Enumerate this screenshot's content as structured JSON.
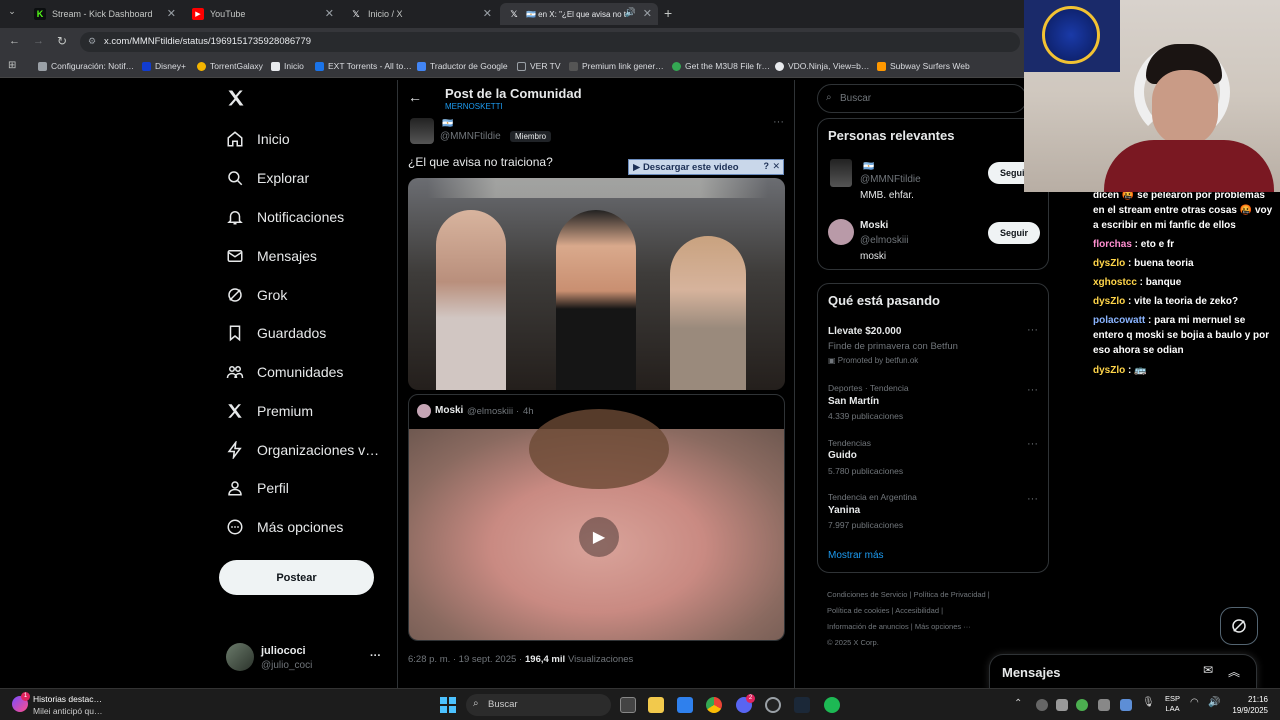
{
  "browser": {
    "tabs": [
      {
        "label": "Stream - Kick Dashboard",
        "favicon": "K",
        "color": "#53fc18"
      },
      {
        "label": "YouTube",
        "favicon": "▶",
        "color": "#ff0000"
      },
      {
        "label": "Inicio / X",
        "favicon": "X",
        "color": "#e8eaed"
      },
      {
        "label": "🇦🇷 en X: \"¿El que avisa no tr…",
        "favicon": "X",
        "color": "#e8eaed"
      }
    ],
    "url": "x.com/MMNFtildie/status/1969151735928086779",
    "bookmarks": [
      {
        "label": "Configuración: Notif…",
        "color": "#9aa0a6"
      },
      {
        "label": "Disney+",
        "color": "#113ccf"
      },
      {
        "label": "TorrentGalaxy",
        "color": "#f4b400"
      },
      {
        "label": "Inicio",
        "color": "#e8eaed"
      },
      {
        "label": "EXT Torrents - All to…",
        "color": "#1a73e8"
      },
      {
        "label": "Traductor de Google",
        "color": "#4285f4"
      },
      {
        "label": "VER TV",
        "color": "#9aa0a6"
      },
      {
        "label": "Premium link gener…",
        "color": "#888"
      },
      {
        "label": "Get the M3U8 File fr…",
        "color": "#34a853"
      },
      {
        "label": "VDO.Ninja, View=b…",
        "color": "#e8eaed"
      },
      {
        "label": "Subway Surfers Web",
        "color": "#ff9800"
      }
    ]
  },
  "nav": {
    "items": [
      "Inicio",
      "Explorar",
      "Notificaciones",
      "Mensajes",
      "Grok",
      "Guardados",
      "Comunidades",
      "Premium",
      "Organizaciones v…",
      "Perfil",
      "Más opciones"
    ],
    "post_button": "Postear",
    "account_name": "juliococi",
    "account_handle": "@julio_coci",
    "more": "···"
  },
  "post": {
    "header_title": "Post de la Comunidad",
    "community": "MERNOSKETTI",
    "author_flag": "🇦🇷",
    "author_handle": "@MMNFtildie",
    "member_badge": "Miembro",
    "text": "¿El que avisa no traiciona?",
    "download_label": "▶ Descargar este video",
    "quote_author": "Moski",
    "quote_handle": "@elmoskiii",
    "quote_time": "4h",
    "time": "6:28 p. m. · 19 sept. 2025 ·",
    "views_count": "196,4 mil",
    "views_label": "Visualizaciones"
  },
  "search": {
    "placeholder": "Buscar"
  },
  "relevant": {
    "title": "Personas relevantes",
    "people": [
      {
        "name": "🇦🇷",
        "handle": "@MMNFtildie",
        "bio": "MMB. ehfar.",
        "button": "Seguir"
      },
      {
        "name": "Moski",
        "handle": "@elmoskiii",
        "bio": "moski",
        "button": "Seguir"
      }
    ]
  },
  "trends": {
    "title": "Qué está pasando",
    "items": [
      {
        "context": "",
        "name": "Llevate $20.000",
        "sub": "Finde de primavera con Betfun",
        "extra": "Promoted by betfun.ok"
      },
      {
        "context": "Deportes · Tendencia",
        "name": "San Martín",
        "sub": "4.339 publicaciones",
        "extra": ""
      },
      {
        "context": "Tendencias",
        "name": "Guido",
        "sub": "5.780 publicaciones",
        "extra": ""
      },
      {
        "context": "Tendencia en Argentina",
        "name": "Yanina",
        "sub": "7.997 publicaciones",
        "extra": ""
      }
    ],
    "show_more": "Mostrar más"
  },
  "footer": {
    "links": [
      "Condiciones de Servicio",
      "Política de Privacidad",
      "Política de cookies",
      "Accesibilidad",
      "Información de anuncios",
      "Más opciones ···"
    ],
    "copyright": "© 2025 X Corp."
  },
  "messages_drawer": {
    "title": "Mensajes"
  },
  "chat": {
    "lines": [
      {
        "user": "",
        "user_color": "#ffffff",
        "text": "dicen 🤬 se pelearon por problemas en el stream entre otras cosas 🤬 voy a escribir en mi fanfic de ellos"
      },
      {
        "user": "florchas",
        "user_color": "#ff8fd0",
        "text": "eto e fr"
      },
      {
        "user": "dysZlo",
        "user_color": "#ffd54a",
        "text": "buena teoria"
      },
      {
        "user": "xghostcc",
        "user_color": "#ffd54a",
        "text": "banque"
      },
      {
        "user": "dysZlo",
        "user_color": "#ffd54a",
        "text": "vite la teoria de zeko?"
      },
      {
        "user": "polacowatt",
        "user_color": "#8ab4ff",
        "text": "para mi mernuel se entero q moski se bojia a baulo y por eso ahora se odian"
      },
      {
        "user": "dysZlo",
        "user_color": "#ffd54a",
        "text": "🚌"
      }
    ]
  },
  "taskbar": {
    "news_title": "Historias destac…",
    "news_sub": "Milei anticipó qu…",
    "news_badge": "1",
    "search_placeholder": "Buscar",
    "discord_badge": "2",
    "lang": "ESP",
    "lang_sub": "LAA",
    "time": "21:16",
    "date": "19/9/2025"
  }
}
